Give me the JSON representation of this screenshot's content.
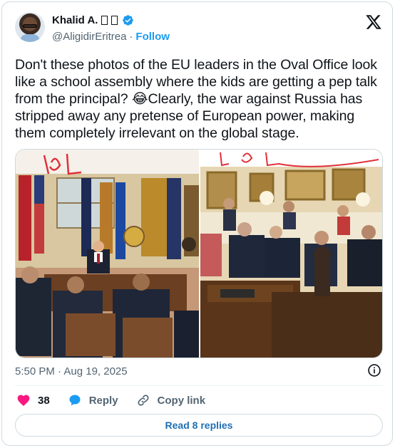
{
  "author": {
    "name": "Khalid A.",
    "handle": "@AligidirEritrea",
    "separator": "·",
    "follow_label": "Follow"
  },
  "tweet": {
    "text": "Don't these photos of the EU leaders in the Oval Office look like a school assembly where the kids are getting a pep talk from the principal? 😂Clearly, the war against Russia has stripped away any pretense of European power, making them completely irrelevant on the global stage."
  },
  "media": {
    "left_annotation": "LOL",
    "right_annotation": "LoL"
  },
  "meta": {
    "timestamp": "5:50 PM · Aug 19, 2025"
  },
  "actions": {
    "like_count": "38",
    "reply_label": "Reply",
    "copy_link_label": "Copy link"
  },
  "footer": {
    "read_replies_label": "Read 8 replies"
  },
  "colors": {
    "accent": "#1d9bf0",
    "like": "#f91880",
    "text": "#0f1419",
    "muted": "#536471"
  }
}
